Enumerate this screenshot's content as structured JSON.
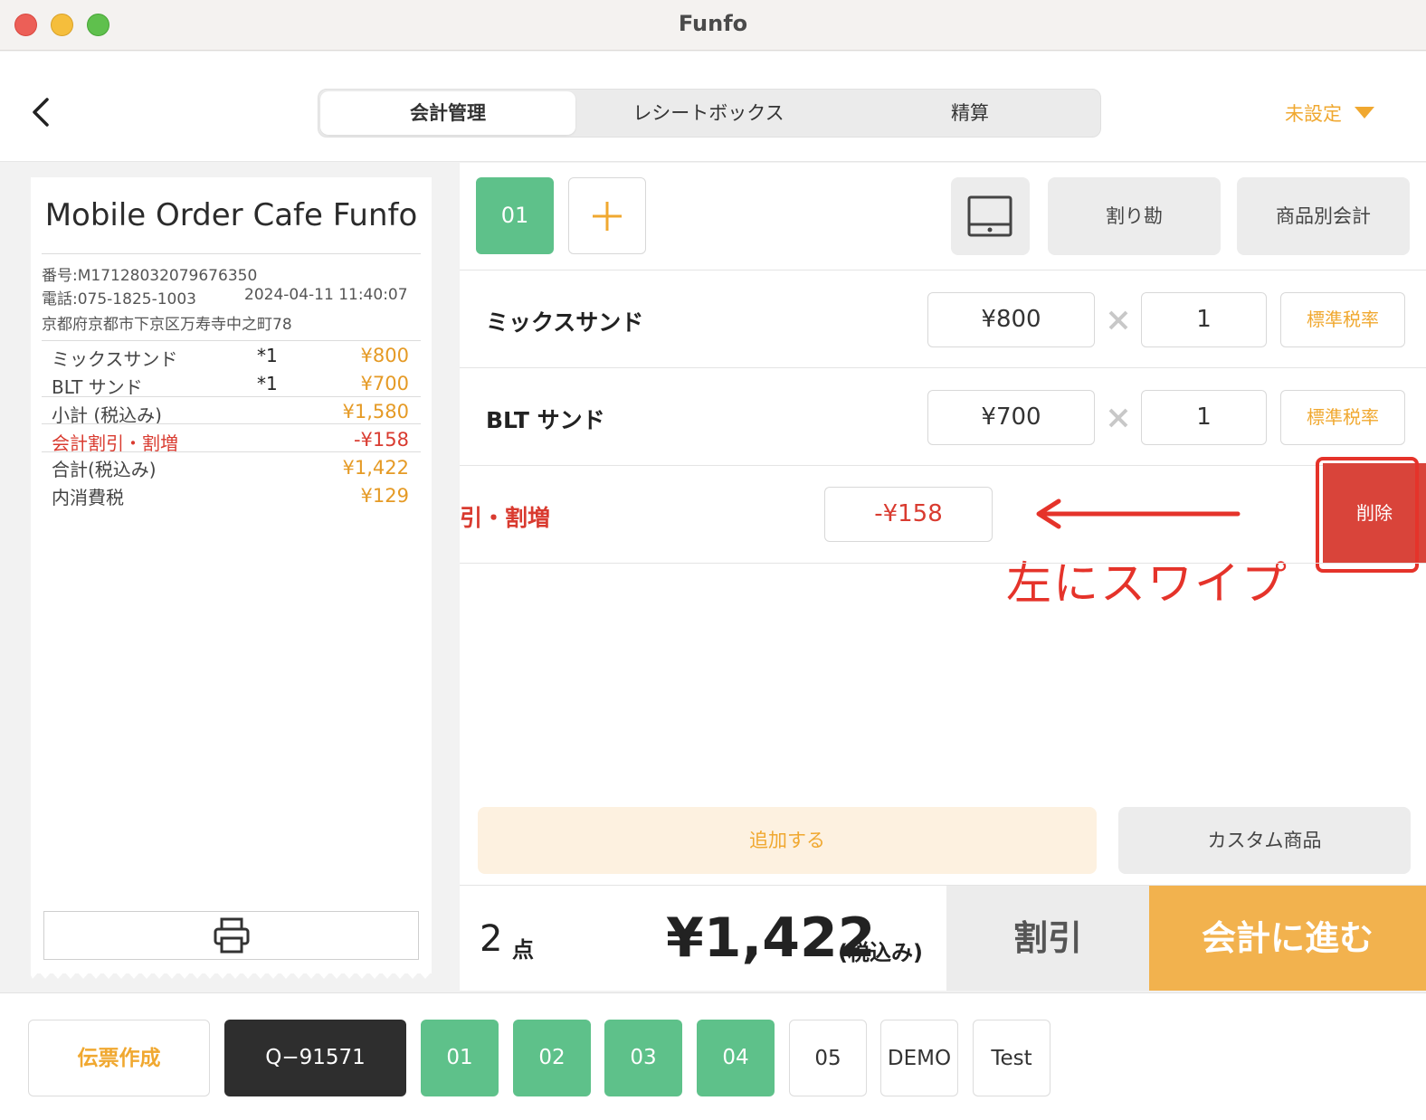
{
  "window": {
    "title": "Funfo"
  },
  "header": {
    "tabs": [
      {
        "label": "会計管理",
        "active": true
      },
      {
        "label": "レシートボックス",
        "active": false
      },
      {
        "label": "精算",
        "active": false
      }
    ],
    "status_label": "未設定"
  },
  "receipt": {
    "shop_name": "Mobile Order Cafe Funfo",
    "number": "番号:M17128032079676350",
    "phone": "電話:075-1825-1003",
    "datetime": "2024-04-11 11:40:07",
    "address": "京都府京都市下京区万寿寺中之町78",
    "items": [
      {
        "name": "ミックスサンド",
        "qty": "*1",
        "price": "¥800"
      },
      {
        "name": "BLT サンド",
        "qty": "*1",
        "price": "¥700"
      }
    ],
    "subtotal_label": "小計 (税込み)",
    "subtotal": "¥1,580",
    "discount_label": "会計割引・割増",
    "discount": "-¥158",
    "total_label": "合計(税込み)",
    "total": "¥1,422",
    "tax_label": "内消費税",
    "tax": "¥129"
  },
  "order": {
    "active_tab": "01",
    "toolbar": {
      "split_label": "割り勘",
      "item_checkout_label": "商品別会計"
    },
    "lines": [
      {
        "name": "ミックスサンド",
        "price": "¥800",
        "qty": "1",
        "tax": "標準税率"
      },
      {
        "name": "BLT サンド",
        "price": "¥700",
        "qty": "1",
        "tax": "標準税率"
      }
    ],
    "discount_line": {
      "name": "引・割増",
      "amount": "-¥158",
      "delete_label": "削除"
    },
    "annotation": "左にスワイプ",
    "add_label": "追加する",
    "custom_label": "カスタム商品",
    "count": "2",
    "count_unit": "点",
    "total": "¥1,422",
    "total_suffix": "(税込み)",
    "discount_button": "割引",
    "checkout_button": "会計に進む"
  },
  "bottom_tabs": [
    {
      "label": "伝票作成",
      "style": "orange"
    },
    {
      "label": "Q−91571",
      "style": "dark"
    },
    {
      "label": "01",
      "style": "green"
    },
    {
      "label": "02",
      "style": "green"
    },
    {
      "label": "03",
      "style": "green"
    },
    {
      "label": "04",
      "style": "green"
    },
    {
      "label": "05",
      "style": "outline"
    },
    {
      "label": "DEMO",
      "style": "outline"
    },
    {
      "label": "Test",
      "style": "outline"
    }
  ],
  "colors": {
    "accent": "#f0a830",
    "green": "#5ec18a",
    "danger": "#d9443a",
    "checkout": "#f2b24e"
  }
}
